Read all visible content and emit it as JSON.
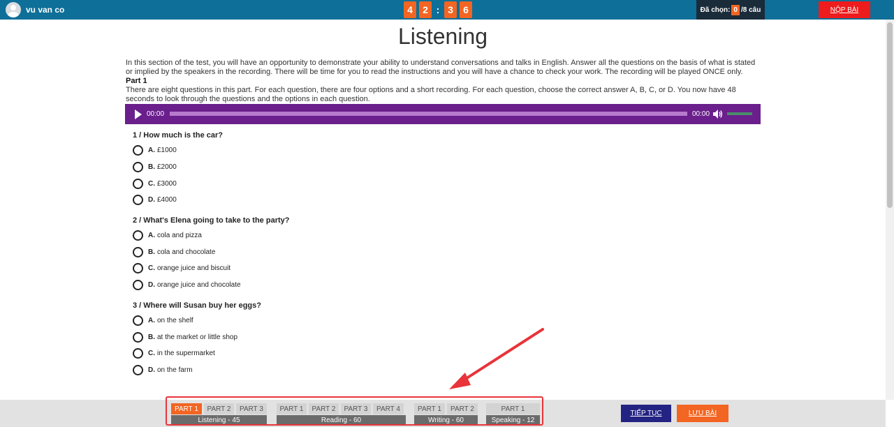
{
  "header": {
    "username": "vu van co",
    "timer": {
      "m1": "4",
      "m2": "2",
      "sep": ":",
      "s1": "3",
      "s2": "6"
    },
    "chosen_label": "Đã chọn:",
    "chosen_count": "0",
    "chosen_total": "/8 câu",
    "submit_label": "NỘP BÀI"
  },
  "page_title": "Listening",
  "intro": {
    "text": "In this section of the test, you will have an opportunity to demonstrate your ability to understand conversations and talks in English. Answer all the questions on the basis of what is stated or implied by the speakers in the recording. There will be time for you to read the instructions and you will have a chance to check your work. The recording will be played ONCE only.",
    "part_title": "Part 1",
    "part_text": "There are eight questions in this part. For each question, there are four options and a short recording. For each question, choose the correct answer A, B, C, or D. You now have 48 seconds to look through the questions and the options in each question."
  },
  "player": {
    "current_time": "00:00",
    "duration": "00:00"
  },
  "questions": [
    {
      "title": "1 / How much is the car?",
      "options": [
        {
          "key": "A.",
          "text": "£1000"
        },
        {
          "key": "B.",
          "text": "£2000"
        },
        {
          "key": "C.",
          "text": "£3000"
        },
        {
          "key": "D.",
          "text": "£4000"
        }
      ]
    },
    {
      "title": "2 / What's Elena going to take to the party?",
      "options": [
        {
          "key": "A.",
          "text": "cola and pizza"
        },
        {
          "key": "B.",
          "text": "cola and chocolate"
        },
        {
          "key": "C.",
          "text": "orange juice and biscuit"
        },
        {
          "key": "D.",
          "text": "orange juice and chocolate"
        }
      ]
    },
    {
      "title": "3 / Where will Susan buy her eggs?",
      "options": [
        {
          "key": "A.",
          "text": "on the shelf"
        },
        {
          "key": "B.",
          "text": "at the market or little shop"
        },
        {
          "key": "C.",
          "text": "in the supermarket"
        },
        {
          "key": "D.",
          "text": "on the farm"
        }
      ]
    }
  ],
  "sections": [
    {
      "label": "Listening - 45",
      "parts": [
        "PART 1",
        "PART 2",
        "PART 3"
      ]
    },
    {
      "label": "Reading - 60",
      "parts": [
        "PART 1",
        "PART 2",
        "PART 3",
        "PART 4"
      ]
    },
    {
      "label": "Writing - 60",
      "parts": [
        "PART 1",
        "PART 2"
      ]
    },
    {
      "label": "Speaking - 12",
      "parts": [
        "PART 1"
      ]
    }
  ],
  "footer": {
    "next_label": "TIẾP TỤC",
    "save_label": "LƯU BÀI"
  },
  "colors": {
    "accent": "#f26522",
    "header": "#0e6f98",
    "player": "#6a1f8c",
    "submit": "#ee1c1c",
    "next": "#232383",
    "highlight": "#e8343a"
  }
}
